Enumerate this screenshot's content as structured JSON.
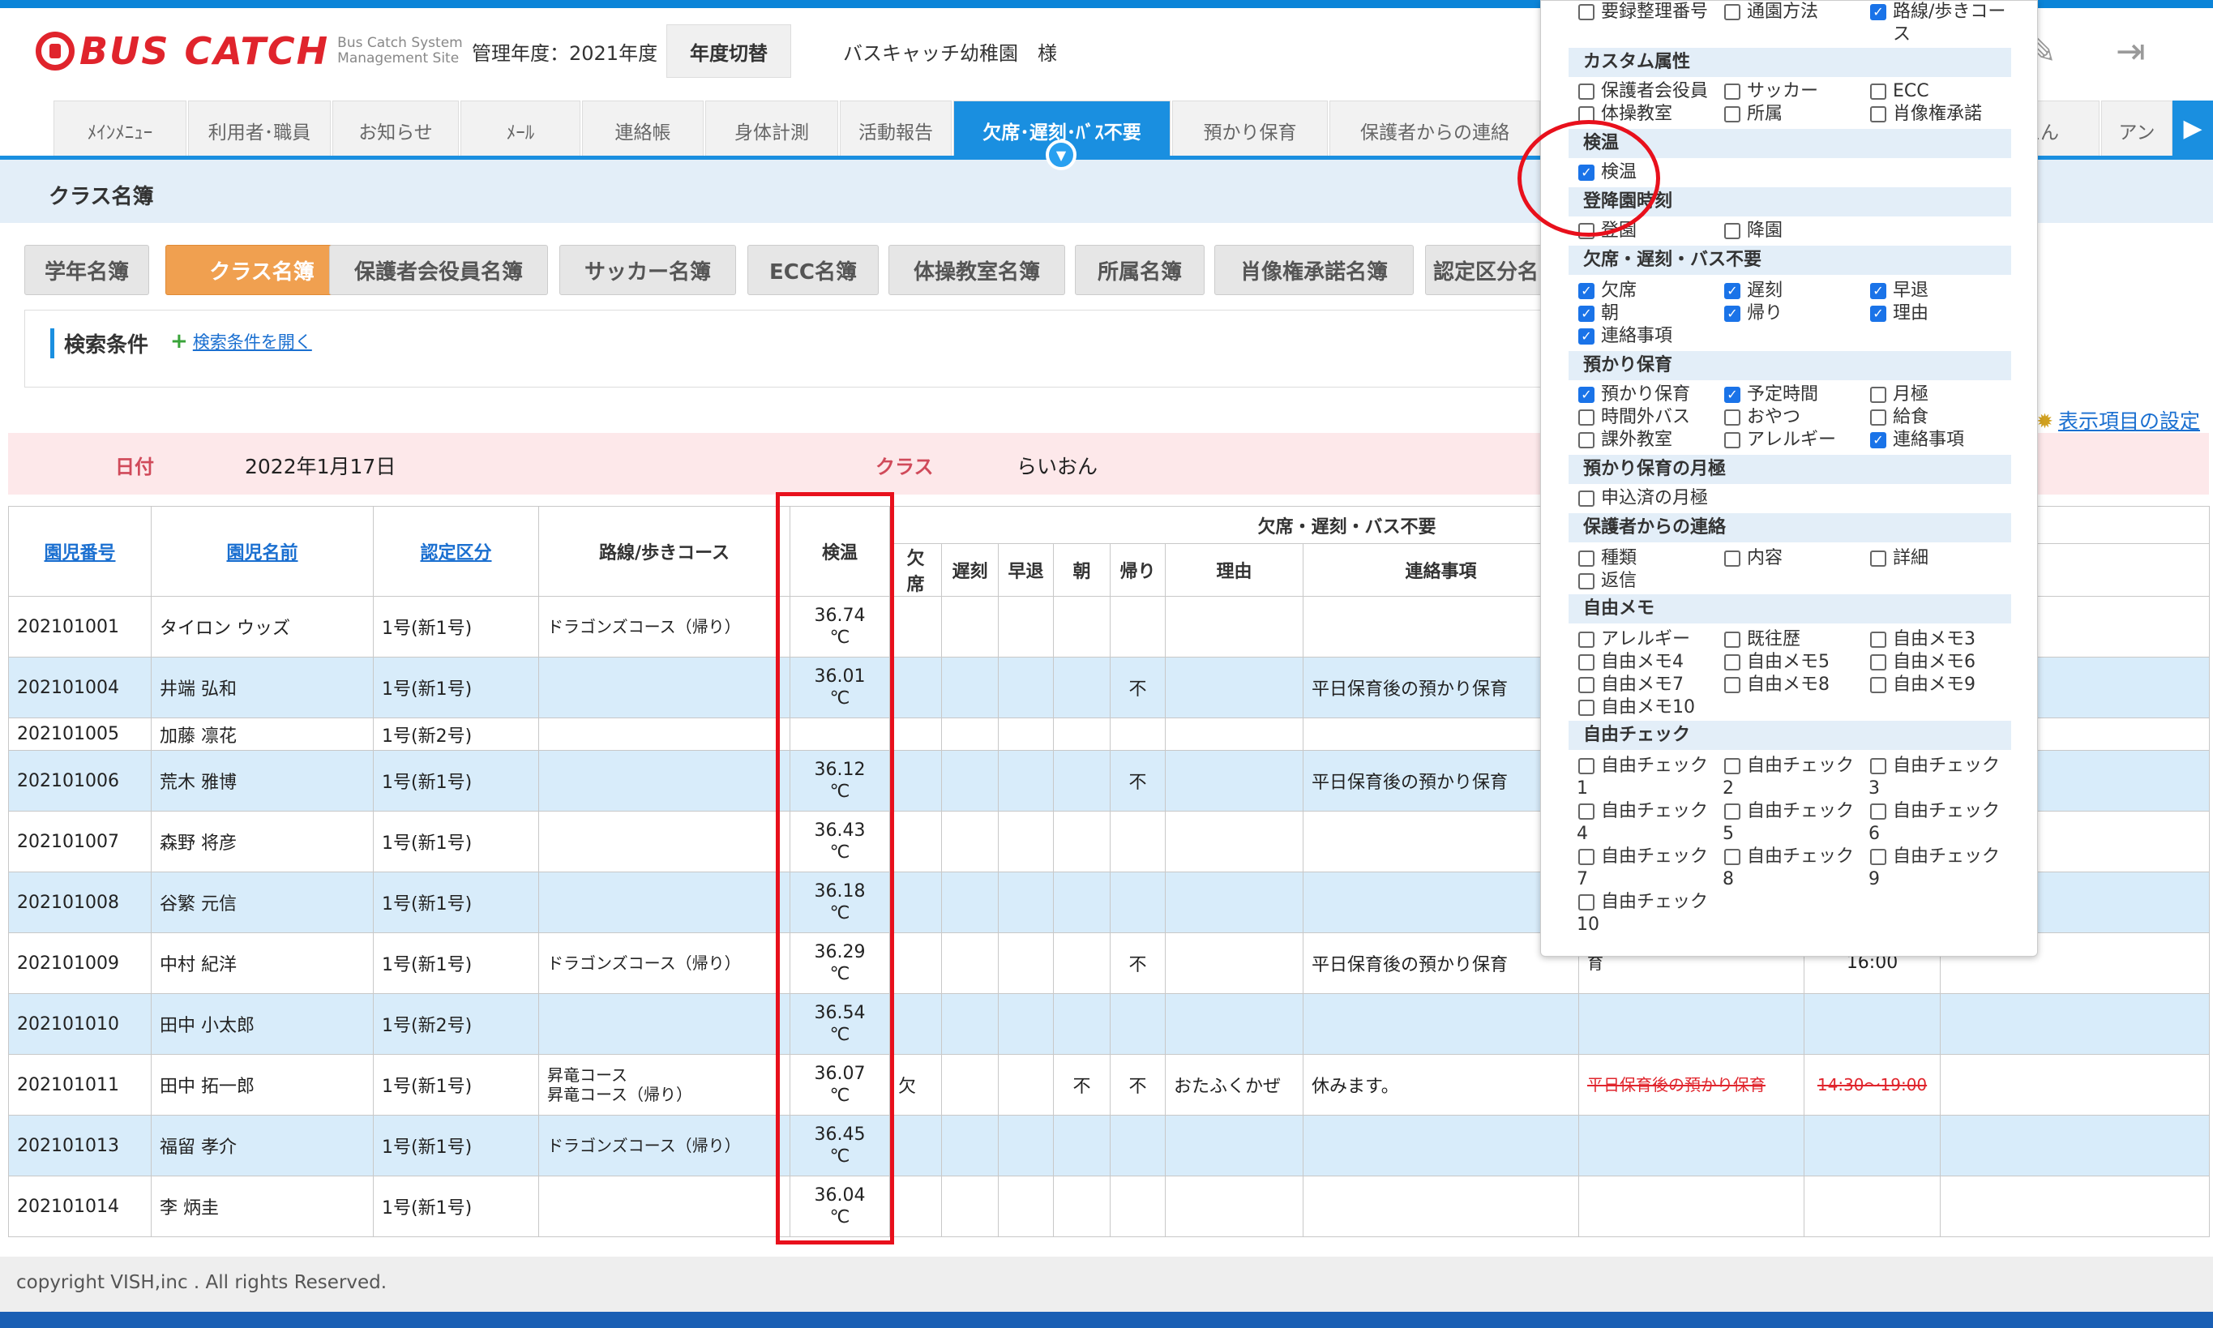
{
  "header": {
    "logo_text": "BUS CATCH",
    "logo_sub": "Bus Catch System Management Site",
    "year_label": "管理年度：2021年度",
    "year_switch": "年度切替",
    "school_name": "バスキャッチ幼稚園　様",
    "icons": [
      "edit-icon",
      "logout-icon"
    ]
  },
  "tabs": [
    {
      "label": "ﾒｲﾝﾒﾆｭｰ"
    },
    {
      "label": "利用者･職員"
    },
    {
      "label": "お知らせ"
    },
    {
      "label": "ﾒｰﾙ"
    },
    {
      "label": "連絡帳"
    },
    {
      "label": "身体計測"
    },
    {
      "label": "活動報告"
    },
    {
      "label": "欠席･遅刻･ﾊﾞｽ不要"
    },
    {
      "label": "預かり保育"
    },
    {
      "label": "保護者からの連絡"
    },
    {
      "label": "えん"
    },
    {
      "label": "アン"
    }
  ],
  "section_title": "クラス名簿",
  "subtabs": [
    {
      "label": "学年名簿"
    },
    {
      "label": "クラス名簿"
    },
    {
      "label": "保護者会役員名簿"
    },
    {
      "label": "サッカー名簿"
    },
    {
      "label": "ECC名簿"
    },
    {
      "label": "体操教室名簿"
    },
    {
      "label": "所属名簿"
    },
    {
      "label": "肖像権承諾名簿"
    },
    {
      "label": "認定区分名"
    }
  ],
  "search": {
    "label": "検索条件",
    "open_link": "検索条件を開く"
  },
  "info": {
    "date_label": "日付",
    "date_value": "2022年1月17日",
    "class_label": "クラス",
    "class_value": "らいおん"
  },
  "display_setting": "表示項目の設定",
  "table": {
    "headers": {
      "id": "園児番号",
      "name": "園児名前",
      "cert": "認定区分",
      "route": "路線/歩きコース",
      "temp": "検温",
      "group_absence": "欠席・遅刻・バス不要",
      "absent": "欠席",
      "late": "遅刻",
      "early": "早退",
      "morning": "朝",
      "return": "帰り",
      "reason": "理由",
      "note": "連絡事項",
      "note2": "連絡事項"
    },
    "rows": [
      {
        "id": "202101001",
        "name": "タイロン ウッズ",
        "cert": "1号(新1号)",
        "route": "ドラゴンズコース（帰り）",
        "temp": "36.74",
        "unit": "℃",
        "absent": "",
        "morning": "",
        "return": "",
        "reason": "",
        "note": "",
        "care": "",
        "time": ""
      },
      {
        "id": "202101004",
        "name": "井端 弘和",
        "cert": "1号(新1号)",
        "route": "",
        "temp": "36.01",
        "unit": "℃",
        "absent": "",
        "morning": "",
        "return": "不",
        "reason": "",
        "note": "平日保育後の預かり保育",
        "care": "",
        "time": ""
      },
      {
        "id": "202101005",
        "name": "加藤 凛花",
        "cert": "1号(新2号)",
        "route": "",
        "temp": "",
        "unit": "",
        "absent": "",
        "morning": "",
        "return": "",
        "reason": "",
        "note": "",
        "care": "",
        "time": ""
      },
      {
        "id": "202101006",
        "name": "荒木 雅博",
        "cert": "1号(新1号)",
        "route": "",
        "temp": "36.12",
        "unit": "℃",
        "absent": "",
        "morning": "",
        "return": "不",
        "reason": "",
        "note": "平日保育後の預かり保育",
        "care": "",
        "time": ""
      },
      {
        "id": "202101007",
        "name": "森野 将彦",
        "cert": "1号(新1号)",
        "route": "",
        "temp": "36.43",
        "unit": "℃",
        "absent": "",
        "morning": "",
        "return": "",
        "reason": "",
        "note": "",
        "care": "",
        "time": ""
      },
      {
        "id": "202101008",
        "name": "谷繁 元信",
        "cert": "1号(新1号)",
        "route": "",
        "temp": "36.18",
        "unit": "℃",
        "absent": "",
        "morning": "",
        "return": "",
        "reason": "",
        "note": "",
        "care": "",
        "time": ""
      },
      {
        "id": "202101009",
        "name": "中村 紀洋",
        "cert": "1号(新1号)",
        "route": "ドラゴンズコース（帰り）",
        "temp": "36.29",
        "unit": "℃",
        "absent": "",
        "morning": "",
        "return": "不",
        "reason": "",
        "note": "平日保育後の預かり保育",
        "care": "育",
        "time": "16:00"
      },
      {
        "id": "202101010",
        "name": "田中 小太郎",
        "cert": "1号(新2号)",
        "route": "",
        "temp": "36.54",
        "unit": "℃",
        "absent": "",
        "morning": "",
        "return": "",
        "reason": "",
        "note": "",
        "care": "",
        "time": ""
      },
      {
        "id": "202101011",
        "name": "田中 拓一郎",
        "cert": "1号(新1号)",
        "route": "昇竜コース",
        "route2": "昇竜コース（帰り）",
        "temp": "36.07",
        "unit": "℃",
        "absent": "欠",
        "morning": "不",
        "return": "不",
        "reason": "おたふくかぜ",
        "note": "休みます。",
        "care": "平日保育後の預かり保育",
        "time": "14:30～19:00"
      },
      {
        "id": "202101013",
        "name": "福留 孝介",
        "cert": "1号(新1号)",
        "route": "ドラゴンズコース（帰り）",
        "temp": "36.45",
        "unit": "℃",
        "absent": "",
        "morning": "",
        "return": "",
        "reason": "",
        "note": "",
        "care": "",
        "time": ""
      },
      {
        "id": "202101014",
        "name": "李 炳圭",
        "cert": "1号(新1号)",
        "route": "",
        "temp": "36.04",
        "unit": "℃",
        "absent": "",
        "morning": "",
        "return": "",
        "reason": "",
        "note": "",
        "care": "",
        "time": ""
      }
    ]
  },
  "popup": {
    "top_row": [
      {
        "label": "要録整理番号",
        "checked": false
      },
      {
        "label": "通園方法",
        "checked": false
      },
      {
        "label": "路線/歩きコース",
        "checked": true
      }
    ],
    "sections": {
      "custom": "カスタム属性",
      "kenon": "検温",
      "arrival": "登降園時刻",
      "absence": "欠席・遅刻・バス不要",
      "care": "預かり保育",
      "care_monthly": "預かり保育の月極",
      "parent": "保護者からの連絡",
      "memo": "自由メモ",
      "check": "自由チェック"
    },
    "custom": [
      {
        "label": "保護者会役員",
        "checked": false
      },
      {
        "label": "サッカー",
        "checked": false
      },
      {
        "label": "ECC",
        "checked": false
      },
      {
        "label": "体操教室",
        "checked": false
      },
      {
        "label": "所属",
        "checked": false
      },
      {
        "label": "肖像権承諾",
        "checked": false
      }
    ],
    "kenon": [
      {
        "label": "検温",
        "checked": true
      }
    ],
    "arrival": [
      {
        "label": "登園",
        "checked": false
      },
      {
        "label": "降園",
        "checked": false
      }
    ],
    "absence": [
      {
        "label": "欠席",
        "checked": true
      },
      {
        "label": "遅刻",
        "checked": true
      },
      {
        "label": "早退",
        "checked": true
      },
      {
        "label": "朝",
        "checked": true
      },
      {
        "label": "帰り",
        "checked": true
      },
      {
        "label": "理由",
        "checked": true
      },
      {
        "label": "連絡事項",
        "checked": true
      }
    ],
    "care": [
      {
        "label": "預かり保育",
        "checked": true
      },
      {
        "label": "予定時間",
        "checked": true
      },
      {
        "label": "月極",
        "checked": false
      },
      {
        "label": "時間外バス",
        "checked": false
      },
      {
        "label": "おやつ",
        "checked": false
      },
      {
        "label": "給食",
        "checked": false
      },
      {
        "label": "課外教室",
        "checked": false
      },
      {
        "label": "アレルギー",
        "checked": false
      },
      {
        "label": "連絡事項",
        "checked": true
      }
    ],
    "care_monthly": [
      {
        "label": "申込済の月極",
        "checked": false
      }
    ],
    "parent": [
      {
        "label": "種類",
        "checked": false
      },
      {
        "label": "内容",
        "checked": false
      },
      {
        "label": "詳細",
        "checked": false
      },
      {
        "label": "返信",
        "checked": false
      }
    ],
    "memo": [
      {
        "label": "アレルギー",
        "checked": false
      },
      {
        "label": "既往歴",
        "checked": false
      },
      {
        "label": "自由メモ3",
        "checked": false
      },
      {
        "label": "自由メモ4",
        "checked": false
      },
      {
        "label": "自由メモ5",
        "checked": false
      },
      {
        "label": "自由メモ6",
        "checked": false
      },
      {
        "label": "自由メモ7",
        "checked": false
      },
      {
        "label": "自由メモ8",
        "checked": false
      },
      {
        "label": "自由メモ9",
        "checked": false
      },
      {
        "label": "自由メモ10",
        "checked": false
      }
    ],
    "check": [
      {
        "label": "自由チェック",
        "num": "1"
      },
      {
        "label": "自由チェック",
        "num": "2"
      },
      {
        "label": "自由チェック",
        "num": "3"
      },
      {
        "label": "自由チェック",
        "num": "4"
      },
      {
        "label": "自由チェック",
        "num": "5"
      },
      {
        "label": "自由チェック",
        "num": "6"
      },
      {
        "label": "自由チェック",
        "num": "7"
      },
      {
        "label": "自由チェック",
        "num": "8"
      },
      {
        "label": "自由チェック",
        "num": "9"
      },
      {
        "label": "自由チェック",
        "num": "10"
      }
    ]
  },
  "footer": "copyright VISH,inc . All rights Reserved.",
  "colors": {
    "brand_red": "#e0242c",
    "tab_blue": "#1a8fe0",
    "active_subtab": "#f0a050",
    "highlight_red": "#e8101c",
    "row_blue": "#d8ecfa"
  }
}
